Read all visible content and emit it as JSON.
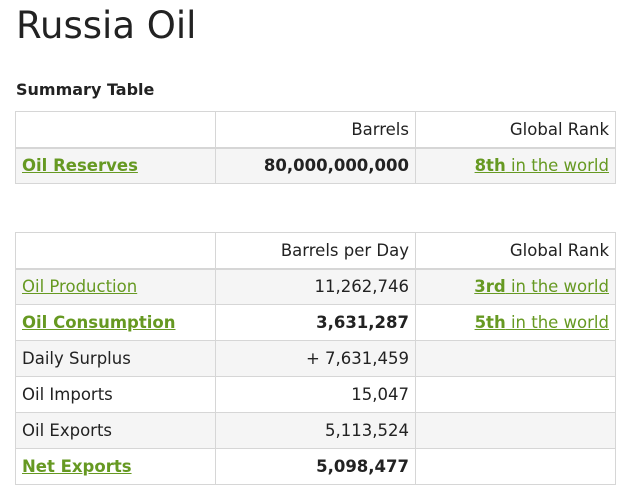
{
  "page": {
    "title": "Russia Oil",
    "section_title": "Summary Table"
  },
  "colors": {
    "link_green": "#669922",
    "text": "#222222",
    "border": "#d6d6d6",
    "row_shade": "#f5f5f5"
  },
  "summary_table": {
    "headers": [
      "",
      "Barrels",
      "Global Rank"
    ],
    "rows": [
      {
        "label": "Oil Reserves",
        "value": "80,000,000,000",
        "rank_num": "8th",
        "rank_suffix": " in the world"
      }
    ]
  },
  "flow_table": {
    "headers": [
      "",
      "Barrels per Day",
      "Global Rank"
    ],
    "rows": [
      {
        "label": "Oil Production",
        "value": "11,262,746",
        "rank_num": "3rd",
        "rank_suffix": " in the world"
      },
      {
        "label": "Oil Consumption",
        "value": "3,631,287",
        "rank_num": "5th",
        "rank_suffix": " in the world"
      },
      {
        "label": "Daily Surplus",
        "value": "+ 7,631,459"
      },
      {
        "label": "Oil Imports",
        "value": "15,047"
      },
      {
        "label": "Oil Exports",
        "value": "5,113,524"
      },
      {
        "label": "Net Exports",
        "value": "5,098,477"
      }
    ]
  }
}
